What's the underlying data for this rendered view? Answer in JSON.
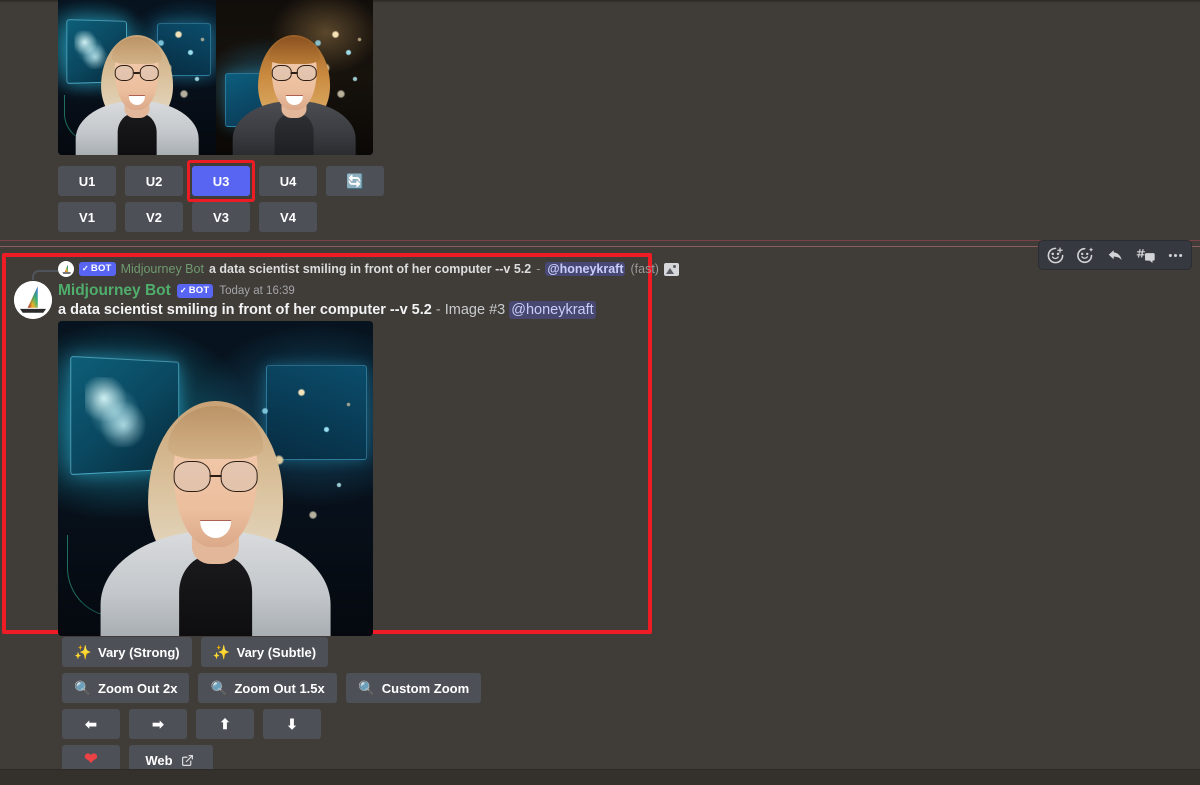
{
  "app": "Discord — Midjourney Bot",
  "grid_message": {
    "image_alt": "midjourney-2x2-grid",
    "upscale_buttons": [
      {
        "label": "U1",
        "name": "upscale-1"
      },
      {
        "label": "U2",
        "name": "upscale-2"
      },
      {
        "label": "U3",
        "name": "upscale-3",
        "selected": true
      },
      {
        "label": "U4",
        "name": "upscale-4"
      }
    ],
    "reroll_button": {
      "icon": "refresh-icon",
      "glyph": "🔄"
    },
    "variation_buttons": [
      {
        "label": "V1",
        "name": "variation-1"
      },
      {
        "label": "V2",
        "name": "variation-2"
      },
      {
        "label": "V3",
        "name": "variation-3"
      },
      {
        "label": "V4",
        "name": "variation-4"
      }
    ]
  },
  "highlighted_message": {
    "reply_reference": {
      "bot_tag": "BOT",
      "bot_check": "✓",
      "author": "Midjourney Bot",
      "text": "a data scientist smiling in front of her computer --v 5.2",
      "separator": "-",
      "mention": "@honeykraft",
      "mode": "(fast)",
      "attachment_icon": "image-attachment-icon"
    },
    "author": "Midjourney Bot",
    "bot_tag": "BOT",
    "bot_check": "✓",
    "timestamp": "Today at 16:39",
    "content": {
      "prompt": "a data scientist smiling in front of her computer --v 5.2",
      "separator": "-",
      "image_label": "Image #3",
      "mention": "@honeykraft"
    },
    "image_alt": "upscaled-data-scientist-image"
  },
  "hover_toolbar": [
    {
      "name": "add-reaction-icon",
      "title": "Add Reaction"
    },
    {
      "name": "super-reaction-icon",
      "title": "Super Reactions"
    },
    {
      "name": "reply-icon",
      "title": "Reply"
    },
    {
      "name": "create-thread-icon",
      "title": "Create Thread"
    },
    {
      "name": "more-options-icon",
      "title": "More"
    }
  ],
  "action_rows": [
    {
      "name": "vary-row",
      "buttons": [
        {
          "label": "Vary (Strong)",
          "icon": "sparkles-icon",
          "glyph": "✨",
          "name": "vary-strong-button"
        },
        {
          "label": "Vary (Subtle)",
          "icon": "sparkles-icon",
          "glyph": "✨",
          "name": "vary-subtle-button"
        }
      ]
    },
    {
      "name": "zoom-row",
      "buttons": [
        {
          "label": "Zoom Out 2x",
          "icon": "magnifier-icon",
          "glyph": "🔍",
          "name": "zoom-out-2x-button"
        },
        {
          "label": "Zoom Out 1.5x",
          "icon": "magnifier-icon",
          "glyph": "🔍",
          "name": "zoom-out-1-5x-button"
        },
        {
          "label": "Custom Zoom",
          "icon": "magnifier-icon",
          "glyph": "🔍",
          "name": "custom-zoom-button"
        }
      ]
    },
    {
      "name": "pan-row",
      "buttons": [
        {
          "label": "",
          "icon": "arrow-left-icon",
          "glyph": "⬅",
          "name": "pan-left-button"
        },
        {
          "label": "",
          "icon": "arrow-right-icon",
          "glyph": "➡",
          "name": "pan-right-button"
        },
        {
          "label": "",
          "icon": "arrow-up-icon",
          "glyph": "⬆",
          "name": "pan-up-button"
        },
        {
          "label": "",
          "icon": "arrow-down-icon",
          "glyph": "⬇",
          "name": "pan-down-button"
        }
      ]
    },
    {
      "name": "misc-row",
      "buttons": [
        {
          "label": "",
          "icon": "heart-icon",
          "glyph": "❤",
          "name": "favorite-button"
        },
        {
          "label": "Web",
          "icon": "external-link-icon",
          "glyph": "↗",
          "name": "web-button"
        }
      ]
    }
  ],
  "colors": {
    "background": "#403c37",
    "annotation_red": "#ee1c25",
    "discord_blurple": "#5865f2",
    "button_grey": "#4e5058",
    "bot_name_green": "#4fae6c",
    "mention_text": "#c9cdfb"
  }
}
